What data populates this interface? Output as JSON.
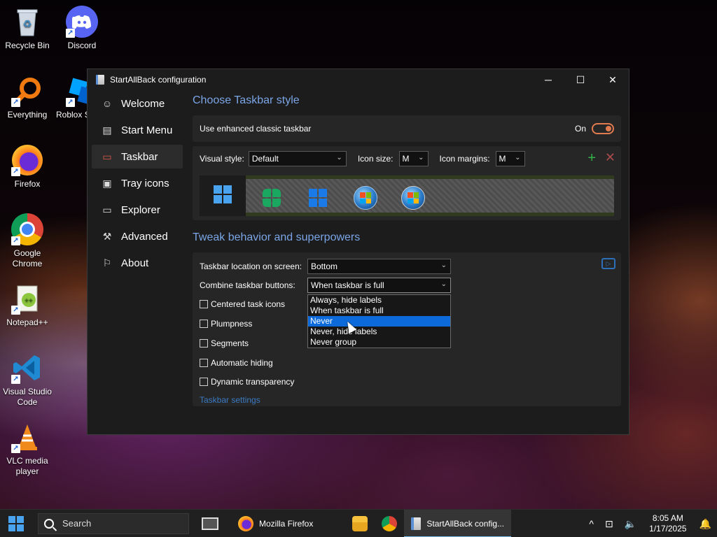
{
  "desktop": {
    "icons": [
      {
        "label": "Recycle Bin",
        "icon": "recycle-bin-icon"
      },
      {
        "label": "Discord",
        "icon": "discord-icon"
      },
      {
        "label": "Everything",
        "icon": "everything-search-icon"
      },
      {
        "label": "Roblox S",
        "icon": "roblox-studio-icon"
      },
      {
        "label": "Firefox",
        "icon": "firefox-icon"
      },
      {
        "label": "Google Chrome",
        "icon": "chrome-icon"
      },
      {
        "label": "Notepad++",
        "icon": "notepad-plus-plus-icon"
      },
      {
        "label": "Visual Studio Code",
        "icon": "vscode-icon"
      },
      {
        "label": "VLC media player",
        "icon": "vlc-icon"
      }
    ]
  },
  "window": {
    "title": "StartAllBack configuration",
    "controls": {
      "minimize": "─",
      "maximize": "☐",
      "close": "✕"
    },
    "sidebar": [
      {
        "label": "Welcome",
        "icon": "smiley-icon",
        "glyph": "ᵕ̈"
      },
      {
        "label": "Start Menu",
        "icon": "start-menu-icon",
        "glyph": "▤"
      },
      {
        "label": "Taskbar",
        "icon": "taskbar-icon",
        "glyph": "▭"
      },
      {
        "label": "Tray icons",
        "icon": "tray-icons-icon",
        "glyph": "▣"
      },
      {
        "label": "Explorer",
        "icon": "folder-icon",
        "glyph": "🗀"
      },
      {
        "label": "Advanced",
        "icon": "wrench-icon",
        "glyph": "🔧"
      },
      {
        "label": "About",
        "icon": "about-icon",
        "glyph": "⚐"
      }
    ],
    "active_nav": "Taskbar",
    "taskbar_style": {
      "heading": "Choose Taskbar style",
      "enhanced_label": "Use enhanced classic taskbar",
      "toggle_state": "On",
      "visual_style_label": "Visual style:",
      "visual_style_value": "Default",
      "icon_size_label": "Icon size:",
      "icon_size_value": "M",
      "icon_margins_label": "Icon margins:",
      "icon_margins_value": "M",
      "add_glyph": "+",
      "remove_glyph": "✕"
    },
    "tweaks": {
      "heading": "Tweak behavior and superpowers",
      "location_label": "Taskbar location on screen:",
      "location_value": "Bottom",
      "combine_label": "Combine taskbar buttons:",
      "combine_value": "When taskbar is full",
      "combine_options": [
        "Always, hide labels",
        "When taskbar is full",
        "Never",
        "Never, hide labels",
        "Never group"
      ],
      "highlighted_option": "Never",
      "checkboxes": [
        "Centered task icons",
        "Plumpness",
        "Segments",
        "Automatic hiding",
        "Dynamic transparency"
      ],
      "settings_link": "Taskbar settings"
    }
  },
  "taskbar": {
    "search_placeholder": "Search",
    "apps": [
      {
        "label": "Mozilla Firefox",
        "icon": "firefox-icon"
      },
      {
        "label": "StartAllBack config...",
        "icon": "startallback-icon"
      }
    ],
    "tray": {
      "chevron": "^",
      "time": "8:05 AM",
      "date": "1/17/2025"
    }
  },
  "colors": {
    "accent_heading": "#7aa5e6",
    "toggle_orange": "#e07a4f",
    "highlight_blue": "#0d6adb",
    "add_green": "#33b24a"
  }
}
